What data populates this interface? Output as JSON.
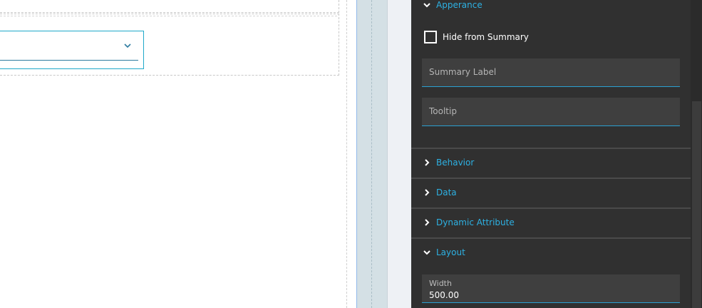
{
  "panel": {
    "sections": {
      "appearance": {
        "title": "Apperance",
        "expanded": true
      },
      "behavior": {
        "title": "Behavior",
        "expanded": false
      },
      "data": {
        "title": "Data",
        "expanded": false
      },
      "dynamic_attribute": {
        "title": "Dynamic Attribute",
        "expanded": false
      },
      "layout": {
        "title": "Layout",
        "expanded": true
      }
    },
    "hide_from_summary": {
      "label": "Hide from Summary",
      "checked": false
    },
    "summary_label": {
      "placeholder": "Summary Label",
      "value": ""
    },
    "tooltip": {
      "placeholder": "Tooltip",
      "value": ""
    },
    "width": {
      "label": "Width",
      "value": "500.00"
    }
  },
  "colors": {
    "accent": "#2db1e3",
    "panel_bg": "#303030",
    "field_bg": "#3f3f3f",
    "dropdown_border": "#1fa9c9"
  },
  "icons": {
    "dropdown": "chevron-down-icon",
    "collapsed": "chevron-right-icon",
    "expanded": "chevron-down-icon"
  }
}
